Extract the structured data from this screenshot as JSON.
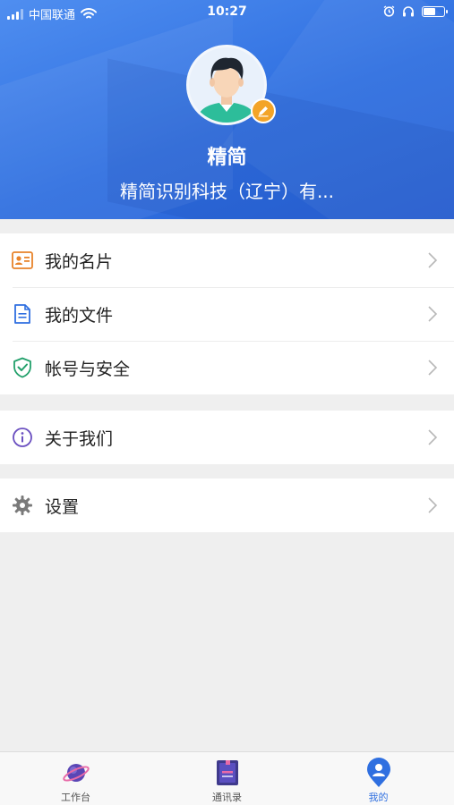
{
  "status_bar": {
    "carrier": "中国联通",
    "time": "10:27",
    "icons": [
      "signal-icon",
      "wifi-icon",
      "alarm-icon",
      "headphones-icon",
      "battery-icon"
    ]
  },
  "profile": {
    "name": "精简",
    "company": "精简识别科技（辽宁）有..."
  },
  "menu_groups": [
    {
      "items": [
        {
          "label": "我的名片",
          "icon": "business-card-icon"
        },
        {
          "label": "我的文件",
          "icon": "document-icon"
        },
        {
          "label": "帐号与安全",
          "icon": "shield-icon"
        }
      ]
    },
    {
      "items": [
        {
          "label": "关于我们",
          "icon": "info-icon"
        }
      ]
    },
    {
      "items": [
        {
          "label": "设置",
          "icon": "gear-icon"
        }
      ]
    }
  ],
  "tabbar": {
    "tabs": [
      {
        "label": "工作台",
        "icon": "planet-icon",
        "active": false
      },
      {
        "label": "通讯录",
        "icon": "contacts-book-icon",
        "active": false
      },
      {
        "label": "我的",
        "icon": "user-pin-icon",
        "active": true
      }
    ]
  },
  "colors": {
    "header_blue": "#2f6fe0",
    "badge_orange": "#f3a428",
    "card_icon_orange": "#e8832a",
    "doc_icon_blue": "#2f6fe0",
    "shield_icon_green": "#22a06b",
    "info_icon_purple": "#6a4fc0",
    "gear_icon_gray": "#7a7a7a"
  }
}
